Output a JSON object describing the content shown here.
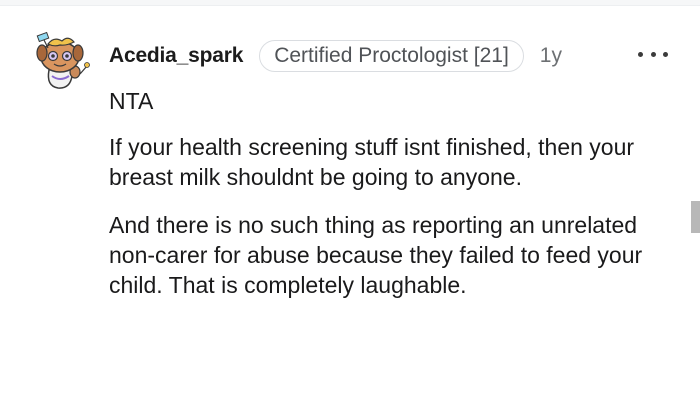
{
  "comment": {
    "author": "Acedia_spark",
    "flair": "Certified Proctologist [21]",
    "age": "1y",
    "more_icon": "more-horizontal-icon",
    "avatar_icon": "snoo-avatar",
    "paragraphs": [
      "NTA",
      "If your health screening stuff isnt finished, then your breast milk shouldnt be going to anyone.",
      "And there is no such thing as reporting an unrelated non-carer for abuse because they failed to feed your child. That is completely laughable."
    ]
  },
  "colors": {
    "text": "#1a1a1b",
    "meta": "#6d7073",
    "flair_border": "#dadde1"
  }
}
